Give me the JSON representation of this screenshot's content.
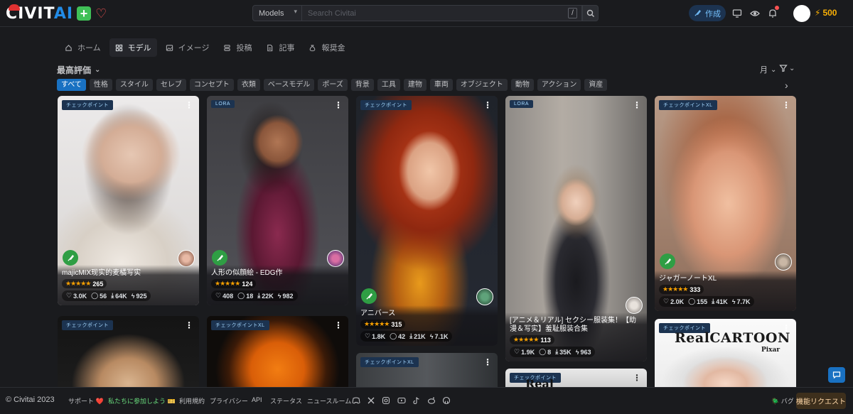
{
  "header": {
    "logo_civit": "CIVIT",
    "logo_ai": "AI",
    "logo_plus": "+",
    "search_scope": "Models",
    "search_placeholder": "Search Civitai",
    "search_kbd": "/",
    "create_label": "作成",
    "buzz_count": "500"
  },
  "nav": {
    "tabs": [
      {
        "label": "ホーム",
        "icon": "home-icon"
      },
      {
        "label": "モデル",
        "icon": "grid-icon",
        "active": true
      },
      {
        "label": "イメージ",
        "icon": "image-icon"
      },
      {
        "label": "投稿",
        "icon": "layers-icon"
      },
      {
        "label": "記事",
        "icon": "file-icon"
      },
      {
        "label": "報奨金",
        "icon": "moneybag-icon"
      }
    ]
  },
  "toolbar": {
    "sort_label": "最高評価",
    "period_label": "月"
  },
  "chips": [
    "すべて",
    "性格",
    "スタイル",
    "セレブ",
    "コンセプト",
    "衣類",
    "ベースモデル",
    "ポーズ",
    "背景",
    "工具",
    "建物",
    "車両",
    "オブジェクト",
    "動物",
    "アクション",
    "資産"
  ],
  "cards": [
    {
      "badge": "チェックポイント",
      "title": "majicMIX现实的麦橘写实",
      "rating": "265",
      "likes": "3.0K",
      "comments": "56",
      "downloads": "64K",
      "buzz": "925"
    },
    {
      "badge": "LORA",
      "title": "人形の似顔絵 - EDG作",
      "rating": "124",
      "likes": "408",
      "comments": "18",
      "downloads": "22K",
      "buzz": "982"
    },
    {
      "badge": "チェックポイント",
      "title": "アニバース",
      "rating": "315",
      "likes": "1.8K",
      "comments": "42",
      "downloads": "21K",
      "buzz": "7.1K"
    },
    {
      "badge": "LORA",
      "title": "[アニメ＆リアル] セクシー服装集！【助漫＆写实】羞耻服装合集",
      "rating": "113",
      "likes": "1.9K",
      "comments": "8",
      "downloads": "35K",
      "buzz": "963"
    },
    {
      "badge": "チェックポイントXL",
      "title": "ジャガーノートXL",
      "rating": "333",
      "likes": "2.0K",
      "comments": "155",
      "downloads": "41K",
      "buzz": "7.7K"
    },
    {
      "badge": "チェックポイント"
    },
    {
      "badge": "チェックポイントXL"
    },
    {
      "badge": "チェックポイントXL"
    },
    {
      "badge": "チェックポイント",
      "overlay_text": "Real"
    },
    {
      "badge": "チェックポイント",
      "overlay_text": "RealCARTOON",
      "overlay_sub": "Pixar"
    }
  ],
  "footer": {
    "copyright": "© Civitai 2023",
    "support": "サポート ❤️",
    "join": "私たちに参加しよう 🎫",
    "terms": "利用規約",
    "privacy": "プライバシー",
    "api": "API",
    "status": "ステータス",
    "newsroom": "ニュースルーム",
    "bug": "🪲 バグ",
    "feature_request": "機能リクエスト"
  },
  "colors": {
    "accent": "#228be6",
    "chip_active": "#1971c2",
    "star": "#f59f00",
    "buzz": "#fab005"
  }
}
